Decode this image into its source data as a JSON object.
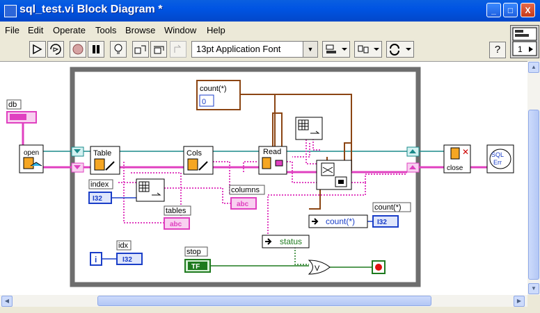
{
  "window": {
    "title": "sql_test.vi Block Diagram *"
  },
  "titlebar_buttons": {
    "minimize": "_",
    "maximize": "□",
    "close": "X"
  },
  "menu": [
    {
      "label": "File"
    },
    {
      "label": "Edit"
    },
    {
      "label": "Operate"
    },
    {
      "label": "Tools"
    },
    {
      "label": "Browse"
    },
    {
      "label": "Window"
    },
    {
      "label": "Help"
    }
  ],
  "toolbar": {
    "font_selector": "13pt Application Font",
    "help": "?",
    "connector_pane_number": "1"
  },
  "diagram": {
    "labels": {
      "db": "db",
      "count_ind": "count(*)",
      "count_ind_value": "0",
      "open": "open",
      "table": "Table",
      "cols": "Cols",
      "read": "Read",
      "close": "close",
      "sql_err": "SQL Err",
      "index": "index",
      "index_type": "I32",
      "tables": "tables",
      "tables_type": "abc",
      "columns": "columns",
      "columns_type": "abc",
      "count_prop": "count(*)",
      "count_out": "count(*)",
      "count_out_type": "I32",
      "status": "status",
      "idx": "idx",
      "idx_type": "I32",
      "iter": "i",
      "stop": "stop",
      "stop_type": "TF",
      "or_op": "V"
    }
  }
}
